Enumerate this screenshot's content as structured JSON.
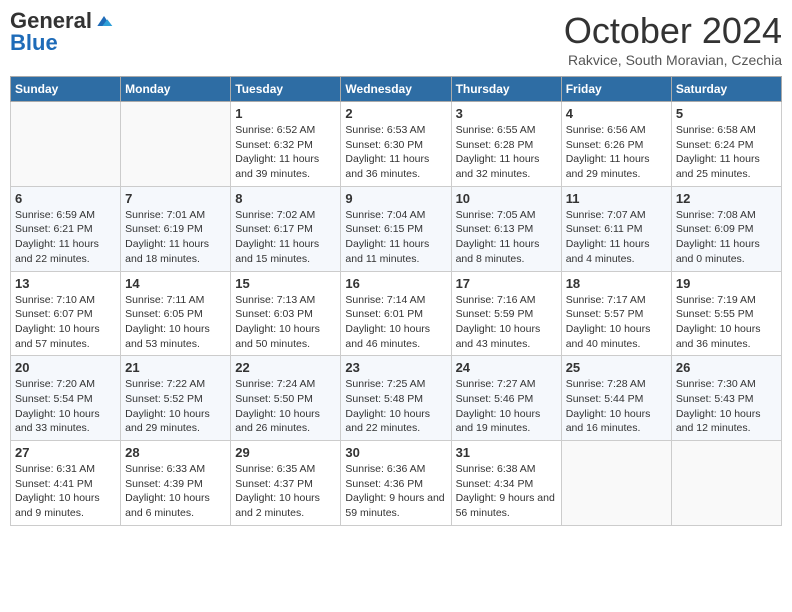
{
  "header": {
    "logo_general": "General",
    "logo_blue": "Blue",
    "month_title": "October 2024",
    "subtitle": "Rakvice, South Moravian, Czechia"
  },
  "days_of_week": [
    "Sunday",
    "Monday",
    "Tuesday",
    "Wednesday",
    "Thursday",
    "Friday",
    "Saturday"
  ],
  "weeks": [
    [
      {
        "day": "",
        "info": ""
      },
      {
        "day": "",
        "info": ""
      },
      {
        "day": "1",
        "info": "Sunrise: 6:52 AM\nSunset: 6:32 PM\nDaylight: 11 hours and 39 minutes."
      },
      {
        "day": "2",
        "info": "Sunrise: 6:53 AM\nSunset: 6:30 PM\nDaylight: 11 hours and 36 minutes."
      },
      {
        "day": "3",
        "info": "Sunrise: 6:55 AM\nSunset: 6:28 PM\nDaylight: 11 hours and 32 minutes."
      },
      {
        "day": "4",
        "info": "Sunrise: 6:56 AM\nSunset: 6:26 PM\nDaylight: 11 hours and 29 minutes."
      },
      {
        "day": "5",
        "info": "Sunrise: 6:58 AM\nSunset: 6:24 PM\nDaylight: 11 hours and 25 minutes."
      }
    ],
    [
      {
        "day": "6",
        "info": "Sunrise: 6:59 AM\nSunset: 6:21 PM\nDaylight: 11 hours and 22 minutes."
      },
      {
        "day": "7",
        "info": "Sunrise: 7:01 AM\nSunset: 6:19 PM\nDaylight: 11 hours and 18 minutes."
      },
      {
        "day": "8",
        "info": "Sunrise: 7:02 AM\nSunset: 6:17 PM\nDaylight: 11 hours and 15 minutes."
      },
      {
        "day": "9",
        "info": "Sunrise: 7:04 AM\nSunset: 6:15 PM\nDaylight: 11 hours and 11 minutes."
      },
      {
        "day": "10",
        "info": "Sunrise: 7:05 AM\nSunset: 6:13 PM\nDaylight: 11 hours and 8 minutes."
      },
      {
        "day": "11",
        "info": "Sunrise: 7:07 AM\nSunset: 6:11 PM\nDaylight: 11 hours and 4 minutes."
      },
      {
        "day": "12",
        "info": "Sunrise: 7:08 AM\nSunset: 6:09 PM\nDaylight: 11 hours and 0 minutes."
      }
    ],
    [
      {
        "day": "13",
        "info": "Sunrise: 7:10 AM\nSunset: 6:07 PM\nDaylight: 10 hours and 57 minutes."
      },
      {
        "day": "14",
        "info": "Sunrise: 7:11 AM\nSunset: 6:05 PM\nDaylight: 10 hours and 53 minutes."
      },
      {
        "day": "15",
        "info": "Sunrise: 7:13 AM\nSunset: 6:03 PM\nDaylight: 10 hours and 50 minutes."
      },
      {
        "day": "16",
        "info": "Sunrise: 7:14 AM\nSunset: 6:01 PM\nDaylight: 10 hours and 46 minutes."
      },
      {
        "day": "17",
        "info": "Sunrise: 7:16 AM\nSunset: 5:59 PM\nDaylight: 10 hours and 43 minutes."
      },
      {
        "day": "18",
        "info": "Sunrise: 7:17 AM\nSunset: 5:57 PM\nDaylight: 10 hours and 40 minutes."
      },
      {
        "day": "19",
        "info": "Sunrise: 7:19 AM\nSunset: 5:55 PM\nDaylight: 10 hours and 36 minutes."
      }
    ],
    [
      {
        "day": "20",
        "info": "Sunrise: 7:20 AM\nSunset: 5:54 PM\nDaylight: 10 hours and 33 minutes."
      },
      {
        "day": "21",
        "info": "Sunrise: 7:22 AM\nSunset: 5:52 PM\nDaylight: 10 hours and 29 minutes."
      },
      {
        "day": "22",
        "info": "Sunrise: 7:24 AM\nSunset: 5:50 PM\nDaylight: 10 hours and 26 minutes."
      },
      {
        "day": "23",
        "info": "Sunrise: 7:25 AM\nSunset: 5:48 PM\nDaylight: 10 hours and 22 minutes."
      },
      {
        "day": "24",
        "info": "Sunrise: 7:27 AM\nSunset: 5:46 PM\nDaylight: 10 hours and 19 minutes."
      },
      {
        "day": "25",
        "info": "Sunrise: 7:28 AM\nSunset: 5:44 PM\nDaylight: 10 hours and 16 minutes."
      },
      {
        "day": "26",
        "info": "Sunrise: 7:30 AM\nSunset: 5:43 PM\nDaylight: 10 hours and 12 minutes."
      }
    ],
    [
      {
        "day": "27",
        "info": "Sunrise: 6:31 AM\nSunset: 4:41 PM\nDaylight: 10 hours and 9 minutes."
      },
      {
        "day": "28",
        "info": "Sunrise: 6:33 AM\nSunset: 4:39 PM\nDaylight: 10 hours and 6 minutes."
      },
      {
        "day": "29",
        "info": "Sunrise: 6:35 AM\nSunset: 4:37 PM\nDaylight: 10 hours and 2 minutes."
      },
      {
        "day": "30",
        "info": "Sunrise: 6:36 AM\nSunset: 4:36 PM\nDaylight: 9 hours and 59 minutes."
      },
      {
        "day": "31",
        "info": "Sunrise: 6:38 AM\nSunset: 4:34 PM\nDaylight: 9 hours and 56 minutes."
      },
      {
        "day": "",
        "info": ""
      },
      {
        "day": "",
        "info": ""
      }
    ]
  ]
}
